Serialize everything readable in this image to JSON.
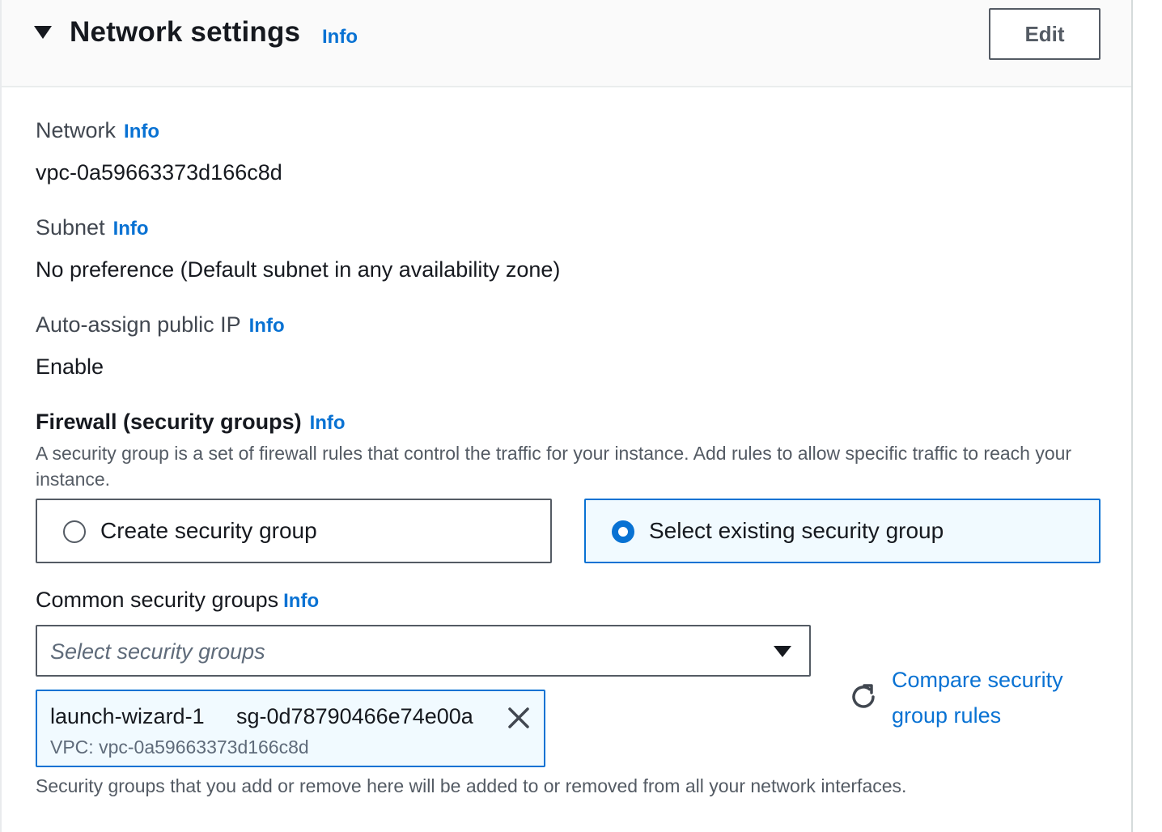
{
  "section": {
    "title": "Network settings",
    "info": "Info",
    "edit_label": "Edit"
  },
  "network": {
    "label": "Network",
    "info": "Info",
    "value": "vpc-0a59663373d166c8d"
  },
  "subnet": {
    "label": "Subnet",
    "info": "Info",
    "value": "No preference (Default subnet in any availability zone)"
  },
  "public_ip": {
    "label": "Auto-assign public IP",
    "info": "Info",
    "value": "Enable"
  },
  "firewall": {
    "title": "Firewall (security groups)",
    "info": "Info",
    "description": "A security group is a set of firewall rules that control the traffic for your instance. Add rules to allow specific traffic to reach your instance.",
    "options": [
      {
        "label": "Create security group",
        "selected": false
      },
      {
        "label": "Select existing security group",
        "selected": true
      }
    ]
  },
  "common_groups": {
    "label": "Common security groups",
    "info": "Info",
    "placeholder": "Select security groups",
    "selected_token": {
      "name": "launch-wizard-1",
      "id": "sg-0d78790466e74e00a",
      "vpc": "VPC: vpc-0a59663373d166c8d"
    },
    "compare_link": "Compare security group rules",
    "footnote": "Security groups that you add or remove here will be added to or removed from all your network interfaces."
  },
  "colors": {
    "link": "#0972d3",
    "selected_bg": "#f1faff",
    "border": "#545b64"
  },
  "icons": [
    "caret-down-icon",
    "radio-icon",
    "dropdown-caret-icon",
    "close-icon",
    "refresh-icon"
  ]
}
